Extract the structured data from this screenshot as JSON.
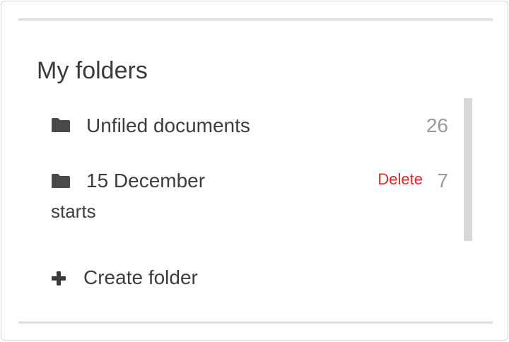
{
  "panel": {
    "title": "My folders"
  },
  "folders": [
    {
      "name": "Unfiled documents",
      "count": "26",
      "icon": "folder-icon"
    },
    {
      "name_line1": "15 December",
      "name_line2": "starts",
      "count": "7",
      "action": "Delete",
      "icon": "folder-icon"
    }
  ],
  "create": {
    "label": "Create folder",
    "icon": "plus-icon"
  },
  "colors": {
    "text": "#3d3d3d",
    "count": "#9a9a9a",
    "delete": "#e0262b",
    "divider": "#dcdcdc",
    "scrollbar": "#d8d8d8"
  }
}
